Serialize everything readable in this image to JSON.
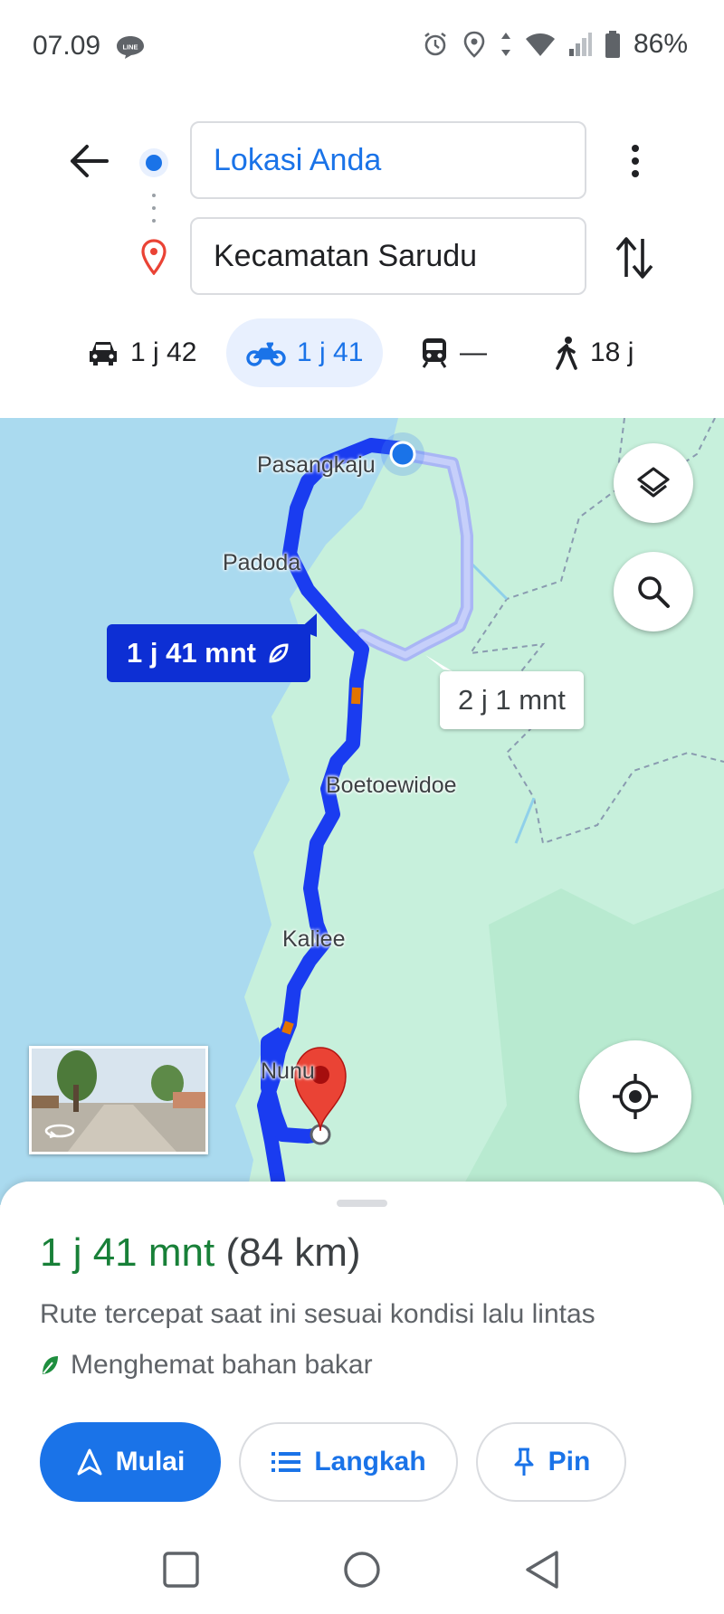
{
  "status_bar": {
    "time": "07.09",
    "line_badge": "LINE",
    "battery": "86%",
    "icons": [
      "line-icon",
      "alarm-icon",
      "location-icon",
      "data-arrows-icon",
      "wifi-icon",
      "signal-icon",
      "battery-icon"
    ]
  },
  "directions": {
    "origin": "Lokasi Anda",
    "destination": "Kecamatan Sarudu"
  },
  "modes": [
    {
      "name": "car",
      "label": "1 j 42"
    },
    {
      "name": "motorcycle",
      "label": "1 j 41",
      "selected": true
    },
    {
      "name": "transit",
      "label": "—"
    },
    {
      "name": "walk",
      "label": "18 j"
    }
  ],
  "map": {
    "places": [
      "Pasangkaju",
      "Padoda",
      "Boetoewidoe",
      "Kaliee",
      "Nunu"
    ],
    "main_route_label": "1 j 41 mnt",
    "alt_route_label": "2 j 1 mnt",
    "colors": {
      "route": "#1a3cf0",
      "alt_route": "#a9b6f5",
      "water": "#aadaef",
      "land": "#c7f0dc"
    }
  },
  "sheet": {
    "duration": "1 j 41 mnt",
    "distance": "(84 km)",
    "description": "Rute tercepat saat ini sesuai kondisi lalu lintas",
    "eco_note": "Menghemat bahan bakar",
    "buttons": {
      "start": "Mulai",
      "steps": "Langkah",
      "pin": "Pin"
    }
  }
}
